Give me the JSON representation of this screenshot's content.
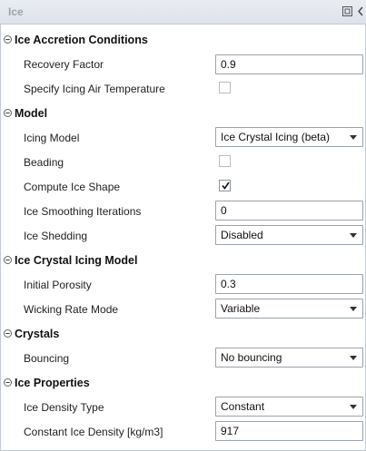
{
  "panel": {
    "title": "Ice"
  },
  "icons": {
    "popout": "popout-icon",
    "collapse": "chevron-left-icon",
    "section_toggle": "minus-circle-icon",
    "dropdown": "chevron-down-icon",
    "check": "check-icon"
  },
  "sections": {
    "accretion": {
      "title": "Ice Accretion Conditions",
      "recovery_factor": {
        "label": "Recovery Factor",
        "value": "0.9"
      },
      "specify_temp": {
        "label": "Specify Icing Air Temperature",
        "checked": false
      }
    },
    "model": {
      "title": "Model",
      "icing_model": {
        "label": "Icing Model",
        "value": "Ice Crystal Icing (beta)"
      },
      "beading": {
        "label": "Beading",
        "checked": false
      },
      "compute_shape": {
        "label": "Compute Ice Shape",
        "checked": true
      },
      "smoothing": {
        "label": "Ice Smoothing Iterations",
        "value": "0"
      },
      "shedding": {
        "label": "Ice Shedding",
        "value": "Disabled"
      }
    },
    "crystal": {
      "title": "Ice Crystal Icing Model",
      "porosity": {
        "label": "Initial Porosity",
        "value": "0.3"
      },
      "wicking": {
        "label": "Wicking Rate Mode",
        "value": "Variable"
      }
    },
    "crystals": {
      "title": "Crystals",
      "bouncing": {
        "label": "Bouncing",
        "value": "No bouncing"
      }
    },
    "properties": {
      "title": "Ice Properties",
      "density_type": {
        "label": "Ice Density Type",
        "value": "Constant"
      },
      "density": {
        "label": "Constant Ice Density [kg/m3]",
        "value": "917"
      }
    }
  }
}
